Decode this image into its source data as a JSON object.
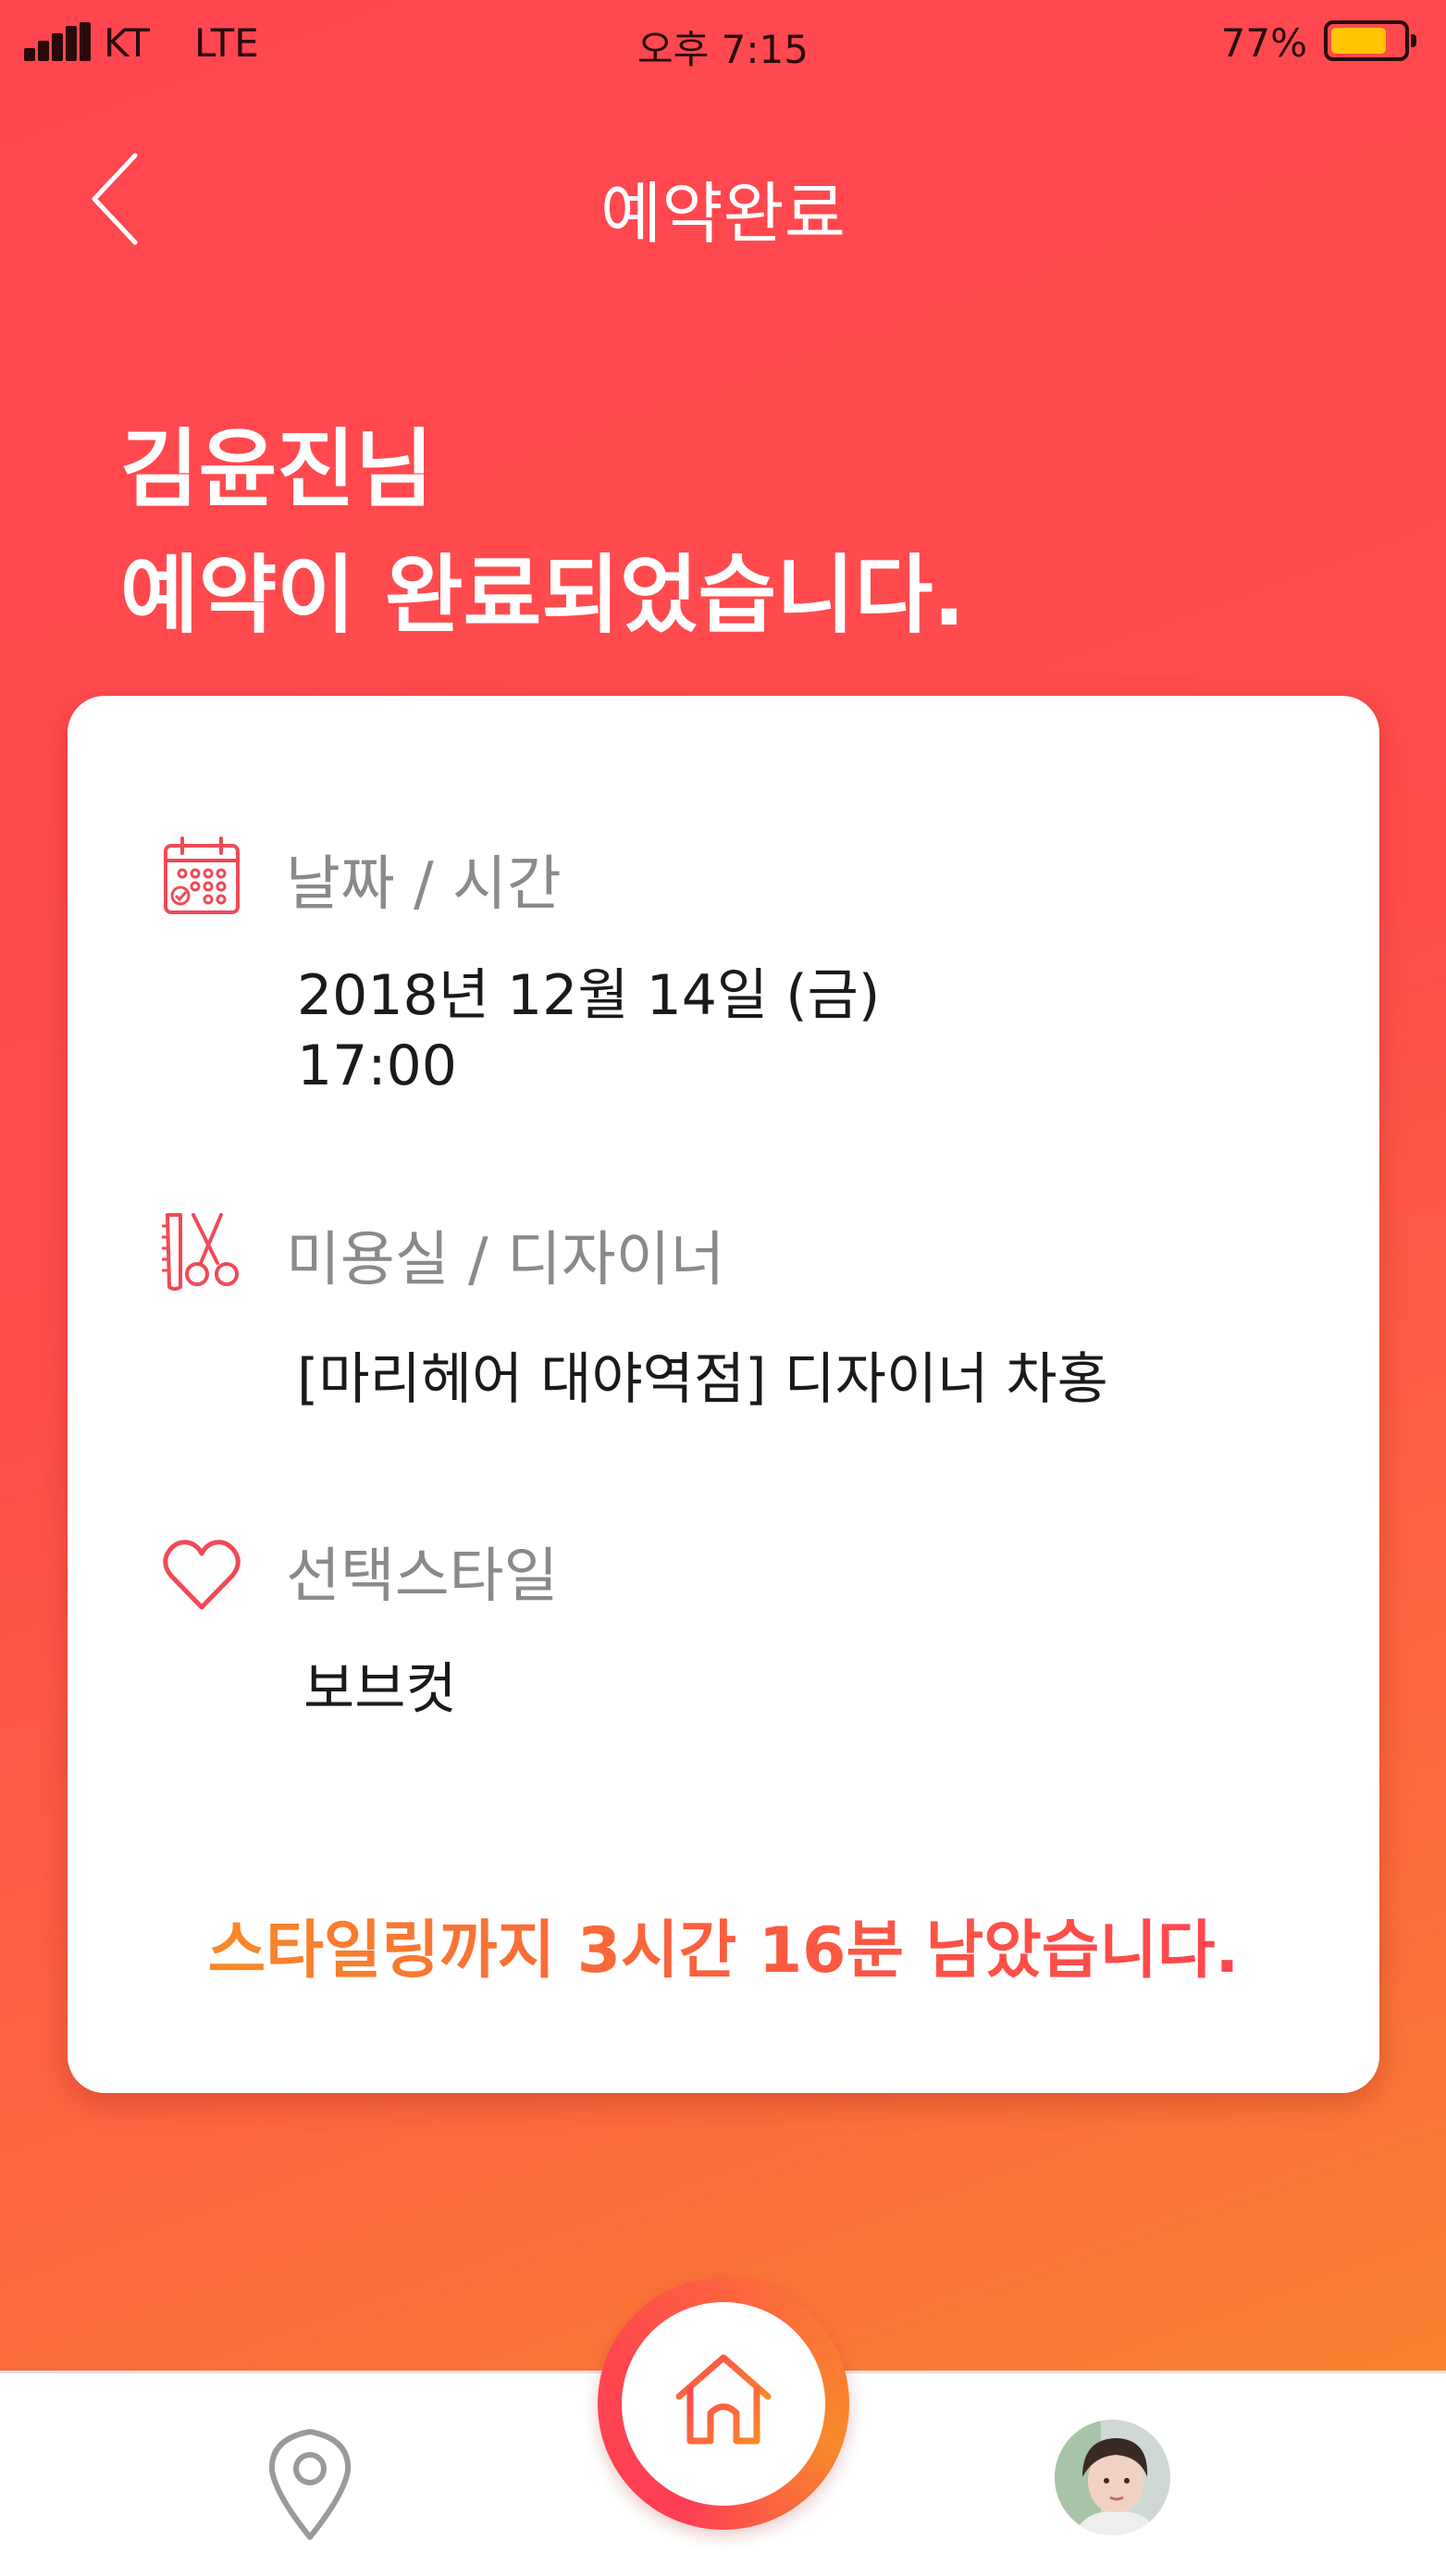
{
  "status_bar": {
    "carrier": "KT",
    "network": "LTE",
    "time": "오후 7:15",
    "battery_percent": "77%",
    "battery_level": 0.77,
    "battery_color": "#ffc500"
  },
  "nav": {
    "title": "예약완료",
    "back_icon": "chevron-left-icon"
  },
  "headline": {
    "line1": "김윤진님",
    "line2": "예약이 완료되었습니다."
  },
  "card": {
    "datetime": {
      "icon": "calendar-icon",
      "label": "날짜 / 시간",
      "date": "2018년 12월 14일 (금)",
      "time": "17:00"
    },
    "salon": {
      "icon": "comb-scissors-icon",
      "label": "미용실 / 디자이너",
      "value": "[마리헤어 대야역점] 디자이너 차홍"
    },
    "style": {
      "icon": "heart-icon",
      "label": "선택스타일",
      "value": "보브컷"
    },
    "remaining": "스타일링까지 3시간 16분 남았습니다."
  },
  "tab_bar": {
    "items": [
      {
        "icon": "location-pin-icon"
      },
      {
        "icon": "home-icon"
      },
      {
        "icon": "profile-avatar"
      }
    ]
  },
  "colors": {
    "accent_red": "#ff4650",
    "accent_orange": "#f7892b",
    "card_bg": "#ffffff",
    "label_gray": "#8a8a8a"
  }
}
